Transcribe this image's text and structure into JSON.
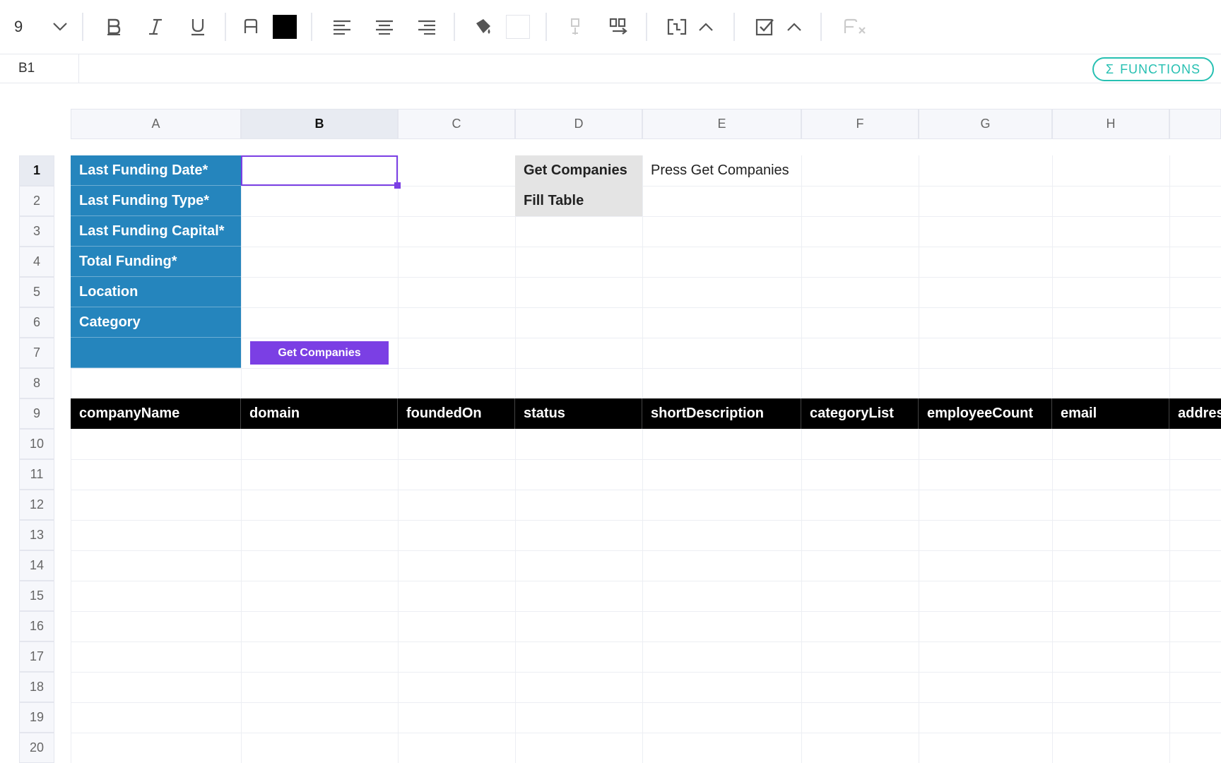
{
  "toolbar": {
    "font_size": "9",
    "icons": [
      "chevron-down-icon",
      "bold-icon",
      "italic-icon",
      "underline-icon",
      "text-color-icon",
      "align-left-icon",
      "align-center-icon",
      "align-right-icon",
      "fill-color-icon",
      "insert-row-icon",
      "insert-column-icon",
      "merge-cells-icon",
      "checkbox-icon",
      "clear-format-icon"
    ],
    "text_color": "#000000"
  },
  "formula_bar": {
    "cell_ref": "B1",
    "value": "",
    "functions_label": "FUNCTIONS",
    "sigma": "Σ"
  },
  "columns": [
    "A",
    "B",
    "C",
    "D",
    "E",
    "F",
    "G",
    "H"
  ],
  "active_column": "B",
  "rows": [
    "1",
    "2",
    "3",
    "4",
    "5",
    "6",
    "7",
    "8",
    "9",
    "10",
    "11",
    "12",
    "13",
    "14",
    "15",
    "16",
    "17",
    "18",
    "19",
    "20"
  ],
  "active_row": "1",
  "cells": {
    "A1": "Last Funding Date*",
    "A2": "Last Funding Type*",
    "A3": "Last Funding Capital*",
    "A4": "Total Funding*",
    "A5": "Location",
    "A6": "Category",
    "A7": "",
    "D1": "Get Companies",
    "D2": "Fill Table",
    "E1": "Press Get Companies"
  },
  "get_companies_button": "Get Companies",
  "table_headers": [
    "companyName",
    "domain",
    "foundedOn",
    "status",
    "shortDescription",
    "categoryList",
    "employeeCount",
    "email",
    "addres"
  ],
  "colors": {
    "label_blue": "#2585bd",
    "accent_purple": "#7b3fe4",
    "functions_teal": "#27c0b2"
  }
}
